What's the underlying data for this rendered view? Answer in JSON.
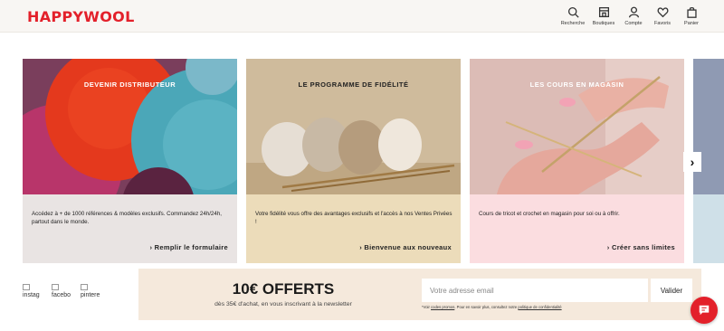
{
  "header": {
    "logo": "HAPPYWOOL",
    "nav": [
      {
        "label": "Recherche",
        "icon": "search-icon"
      },
      {
        "label": "Boutiques",
        "icon": "store-icon"
      },
      {
        "label": "Compte",
        "icon": "user-icon"
      },
      {
        "label": "Favoris",
        "icon": "heart-icon"
      },
      {
        "label": "Panier",
        "icon": "bag-icon"
      }
    ]
  },
  "cards": [
    {
      "title": "DEVENIR DISTRIBUTEUR",
      "description": "Accédez à + de 1000 références & modèles exclusifs. Commandez 24h/24h, partout dans le monde.",
      "cta": "› Remplir le formulaire"
    },
    {
      "title": "LE PROGRAMME DE FIDÉLITÉ",
      "description": "Votre fidélité vous offre des avantages exclusifs et l'accès à nos Ventes Privées !",
      "cta": "› Bienvenue aux nouveaux"
    },
    {
      "title": "LES COURS EN MAGASIN",
      "description": "Cours de tricot et crochet en magasin pour soi ou à offrir.",
      "cta": "› Créer sans limites"
    }
  ],
  "carousel": {
    "next_icon": "chevron-right-icon"
  },
  "social": [
    {
      "alt": "instag"
    },
    {
      "alt": "facebo"
    },
    {
      "alt": "pintere"
    }
  ],
  "newsletter": {
    "title": "10€ OFFERTS",
    "subtitle": "dès 35€ d'achat, en vous inscrivant à la newsletter",
    "placeholder": "Votre adresse email",
    "button": "Valider",
    "legal_prefix": "*Voir ",
    "legal_link1": "codes promos",
    "legal_middle": ". Pour en savoir plus, consultez notre ",
    "legal_link2": "politique de confidentialité"
  },
  "colors": {
    "brand": "#e3202a",
    "newsletter_bg": "#f5e9dc"
  }
}
